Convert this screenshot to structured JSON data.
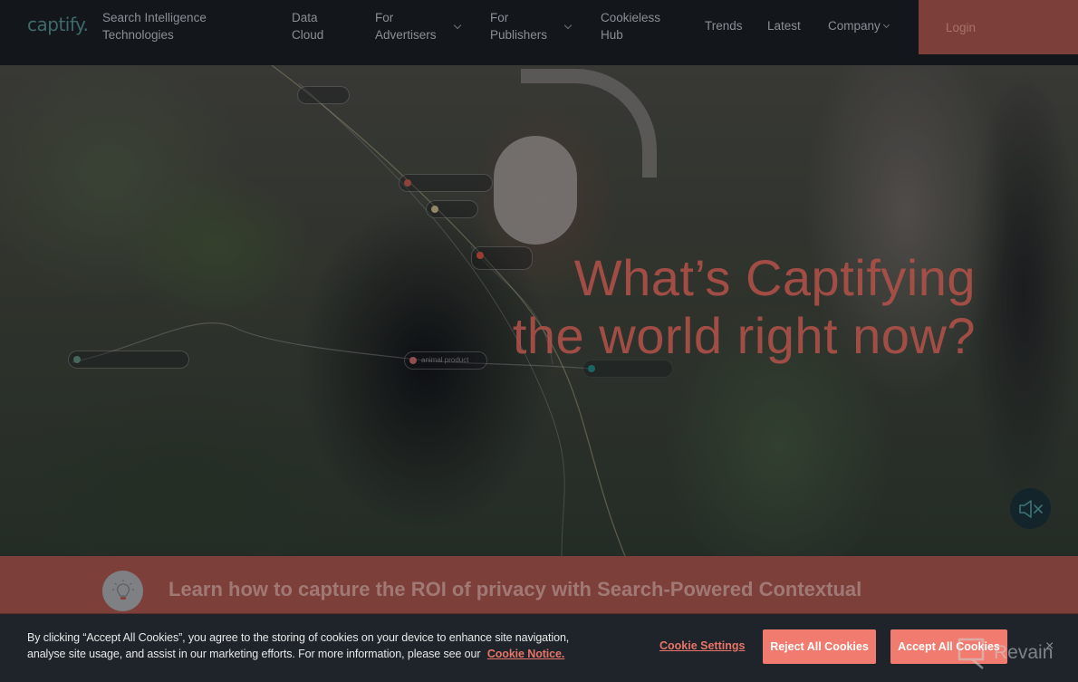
{
  "header": {
    "logo": "captify",
    "logo_dot": ".",
    "tagline_line1": "Search Intelligence",
    "tagline_line2": "Technologies",
    "nav": [
      {
        "line1": "Data",
        "line2": "Cloud",
        "has_dropdown": false
      },
      {
        "line1": "For",
        "line2": "Advertisers",
        "has_dropdown": true
      },
      {
        "line1": "For",
        "line2": "Publishers",
        "has_dropdown": true
      },
      {
        "line1": "Cookieless",
        "line2": "Hub",
        "has_dropdown": false
      },
      {
        "line1": "Trends",
        "has_dropdown": false
      },
      {
        "line1": "Latest",
        "has_dropdown": false
      },
      {
        "line1": "Company",
        "has_dropdown": true
      }
    ],
    "login_label": "Login",
    "colors": {
      "background": "#13171c",
      "login_bg": "#7d3f39",
      "logo": "#3f6a6a"
    }
  },
  "hero": {
    "headline_line1": "What’s Captifying",
    "headline_line2": "the world right now?",
    "overlay_chip_label": "animal product",
    "mute_icon": "speaker-muted-icon",
    "colors": {
      "headline": "#b5524a",
      "mute_bg": "#13242b"
    }
  },
  "promo": {
    "icon": "lightbulb-icon",
    "text": "Learn how to capture the ROI of privacy with Search-Powered Contextual",
    "colors": {
      "background": "#7d3f3a"
    }
  },
  "cookie_banner": {
    "text": "By clicking “Accept All Cookies”, you agree to the storing of cookies on your device to enhance site navigation, analyse site usage, and assist in our marketing efforts. For more information, please see our",
    "notice_link": "Cookie Notice.",
    "settings_label": "Cookie Settings",
    "reject_label": "Reject All Cookies",
    "accept_label": "Accept All Cookies",
    "close_icon": "×",
    "colors": {
      "background": "#1e2429",
      "button": "#f07b6e",
      "link": "#e87468"
    }
  },
  "watermark": {
    "text": "Revain"
  }
}
